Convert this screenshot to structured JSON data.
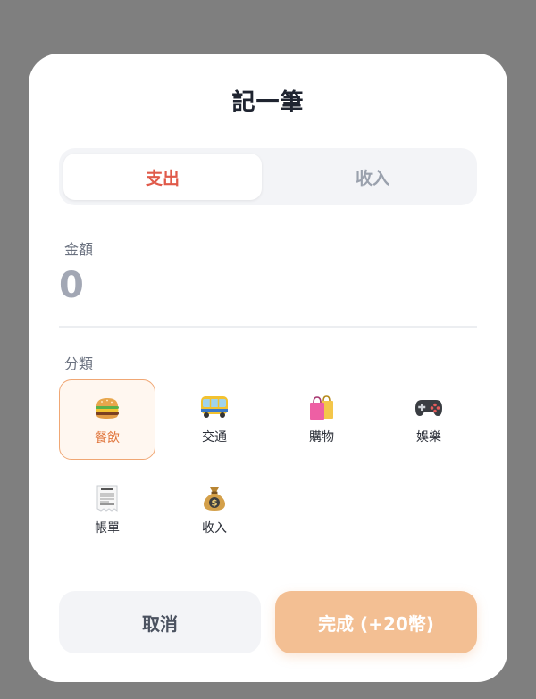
{
  "modal": {
    "title": "記一筆"
  },
  "type_toggle": {
    "expense_label": "支出",
    "income_label": "收入",
    "selected": "expense"
  },
  "amount": {
    "label": "金額",
    "value": "0"
  },
  "category": {
    "label": "分類",
    "items": [
      {
        "label": "餐飲",
        "icon": "burger-icon",
        "selected": true
      },
      {
        "label": "交通",
        "icon": "bus-icon",
        "selected": false
      },
      {
        "label": "購物",
        "icon": "shopping-bags-icon",
        "selected": false
      },
      {
        "label": "娛樂",
        "icon": "game-controller-icon",
        "selected": false
      },
      {
        "label": "帳單",
        "icon": "receipt-icon",
        "selected": false
      },
      {
        "label": "收入",
        "icon": "money-bag-icon",
        "selected": false
      }
    ]
  },
  "actions": {
    "cancel_label": "取消",
    "done_label": "完成 (+20幣)"
  },
  "colors": {
    "accent": "#e05a4a",
    "selected_category": "#e0743a",
    "primary_button": "#f3bf93"
  }
}
